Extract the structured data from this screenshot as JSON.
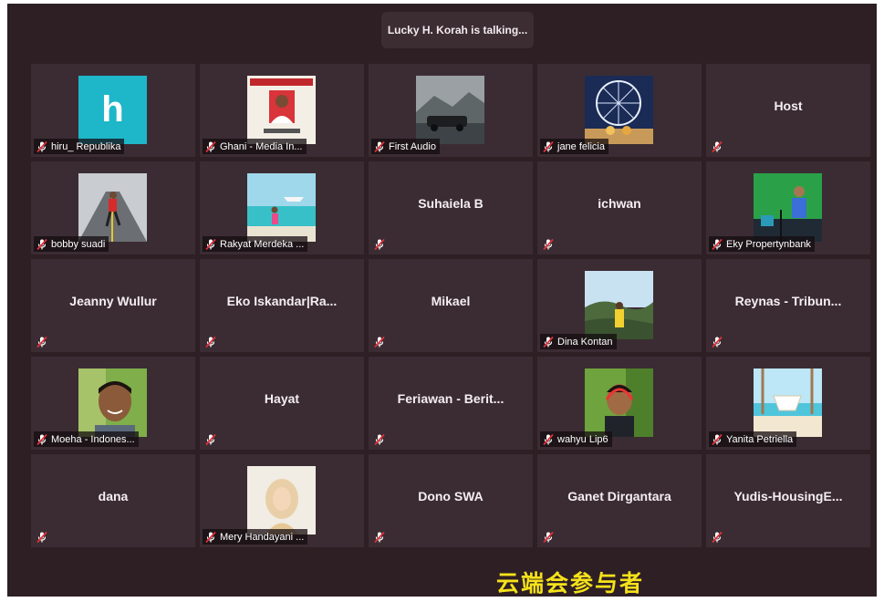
{
  "banner": {
    "talking": "Lucky H. Korah is talking..."
  },
  "participants": [
    {
      "name": "hiru_ Republika",
      "type": "initial",
      "initial": "h",
      "bg": "#1eb6c9"
    },
    {
      "name": "Ghani - Media In...",
      "type": "photo",
      "photo": "id-card-icon"
    },
    {
      "name": "First Audio",
      "type": "photo",
      "photo": "car-mountain-photo"
    },
    {
      "name": "jane felicia",
      "type": "photo",
      "photo": "ferris-wheel-photo"
    },
    {
      "name": "",
      "title": "Host",
      "type": "text"
    },
    {
      "name": "bobby suadi",
      "type": "photo",
      "photo": "runner-photo"
    },
    {
      "name": "Rakyat Merdeka ...",
      "type": "photo",
      "photo": "beach-photo"
    },
    {
      "name": "",
      "title": "Suhaiela B",
      "type": "text"
    },
    {
      "name": "",
      "title": "ichwan",
      "type": "text"
    },
    {
      "name": "Eky Propertynbank",
      "type": "photo",
      "photo": "studio-photo"
    },
    {
      "name": "",
      "title": "Jeanny Wullur",
      "type": "text"
    },
    {
      "name": "",
      "title": "Eko  Iskandar|Ra...",
      "type": "text"
    },
    {
      "name": "",
      "title": "Mikael",
      "type": "text"
    },
    {
      "name": "Dina Kontan",
      "type": "photo",
      "photo": "hill-person-photo"
    },
    {
      "name": "",
      "title": "Reynas - Tribun...",
      "type": "text"
    },
    {
      "name": "Moeha - Indones...",
      "type": "photo",
      "photo": "smiling-man-photo"
    },
    {
      "name": "",
      "title": "Hayat",
      "type": "text"
    },
    {
      "name": "",
      "title": "Feriawan - Berit...",
      "type": "text"
    },
    {
      "name": "wahyu Lip6",
      "type": "photo",
      "photo": "headset-man-photo"
    },
    {
      "name": "Yanita Petriella",
      "type": "photo",
      "photo": "beach-swing-photo"
    },
    {
      "name": "",
      "title": "dana",
      "type": "text"
    },
    {
      "name": "Mery Handayani ...",
      "type": "photo",
      "photo": "hijab-woman-photo"
    },
    {
      "name": "",
      "title": "Dono SWA",
      "type": "text"
    },
    {
      "name": "",
      "title": "Ganet Dirgantara",
      "type": "text"
    },
    {
      "name": "",
      "title": "Yudis-HousingE...",
      "type": "text"
    }
  ],
  "caption": "云端会参与者",
  "colors": {
    "bg": "#2e1f25",
    "tile": "#3b2c33",
    "mute": "#e0303a",
    "caption": "#f5e21a"
  }
}
